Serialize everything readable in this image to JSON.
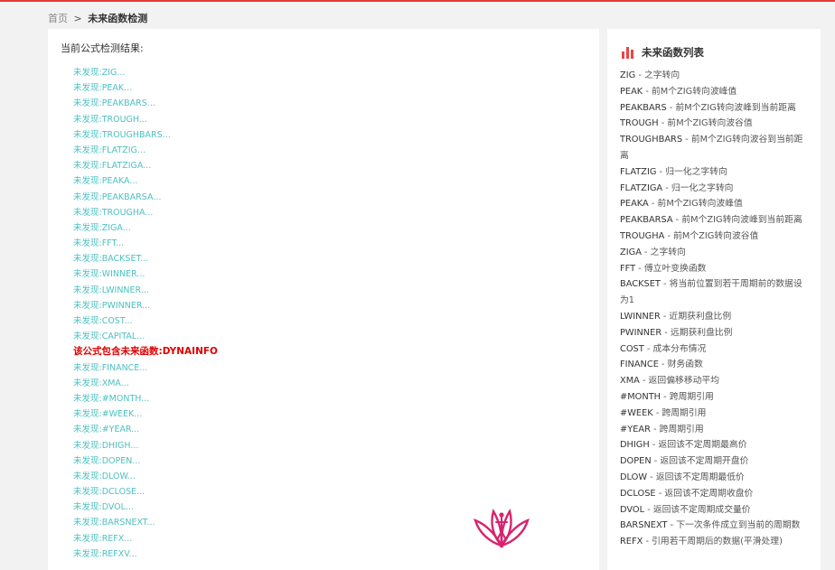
{
  "breadcrumb": {
    "home": "首页",
    "separator": ">",
    "current": "未来函数检测"
  },
  "left": {
    "title": "当前公式检测结果:",
    "results": [
      {
        "text": "未发现:ZIG...",
        "found": false
      },
      {
        "text": "未发现:PEAK...",
        "found": false
      },
      {
        "text": "未发现:PEAKBARS...",
        "found": false
      },
      {
        "text": "未发现:TROUGH...",
        "found": false
      },
      {
        "text": "未发现:TROUGHBARS...",
        "found": false
      },
      {
        "text": "未发现:FLATZIG...",
        "found": false
      },
      {
        "text": "未发现:FLATZIGA...",
        "found": false
      },
      {
        "text": "未发现:PEAKA...",
        "found": false
      },
      {
        "text": "未发现:PEAKBARSA...",
        "found": false
      },
      {
        "text": "未发现:TROUGHA...",
        "found": false
      },
      {
        "text": "未发现:ZIGA...",
        "found": false
      },
      {
        "text": "未发现:FFT...",
        "found": false
      },
      {
        "text": "未发现:BACKSET...",
        "found": false
      },
      {
        "text": "未发现:WINNER...",
        "found": false
      },
      {
        "text": "未发现:LWINNER...",
        "found": false
      },
      {
        "text": "未发现:PWINNER...",
        "found": false
      },
      {
        "text": "未发现:COST...",
        "found": false
      },
      {
        "text": "未发现:CAPITAL...",
        "found": false
      },
      {
        "text": "该公式包含未来函数:DYNAINFO",
        "found": true
      },
      {
        "text": "未发现:FINANCE...",
        "found": false
      },
      {
        "text": "未发现:XMA...",
        "found": false
      },
      {
        "text": "未发现:#MONTH...",
        "found": false
      },
      {
        "text": "未发现:#WEEK...",
        "found": false
      },
      {
        "text": "未发现:#YEAR...",
        "found": false
      },
      {
        "text": "未发现:DHIGH...",
        "found": false
      },
      {
        "text": "未发现:DOPEN...",
        "found": false
      },
      {
        "text": "未发现:DLOW...",
        "found": false
      },
      {
        "text": "未发现:DCLOSE...",
        "found": false
      },
      {
        "text": "未发现:DVOL...",
        "found": false
      },
      {
        "text": "未发现:BARSNEXT...",
        "found": false
      },
      {
        "text": "未发现:REFX...",
        "found": false
      },
      {
        "text": "未发现:REFXV...",
        "found": false
      }
    ]
  },
  "right": {
    "icon": "bar-chart-icon",
    "title": "未来函数列表",
    "functions": [
      {
        "name": "ZIG",
        "desc": " - 之字转向"
      },
      {
        "name": "PEAK",
        "desc": " - 前M个ZIG转向波峰值"
      },
      {
        "name": "PEAKBARS",
        "desc": " - 前M个ZIG转向波峰到当前距离"
      },
      {
        "name": "TROUGH",
        "desc": " - 前M个ZIG转向波谷值"
      },
      {
        "name": "TROUGHBARS",
        "desc": " - 前M个ZIG转向波谷到当前距离"
      },
      {
        "name": "FLATZIG",
        "desc": " - 归一化之字转向"
      },
      {
        "name": "FLATZIGA",
        "desc": " - 归一化之字转向"
      },
      {
        "name": "PEAKA",
        "desc": " - 前M个ZIG转向波峰值"
      },
      {
        "name": "PEAKBARSA",
        "desc": " - 前M个ZIG转向波峰到当前距离"
      },
      {
        "name": "TROUGHA",
        "desc": " - 前M个ZIG转向波谷值"
      },
      {
        "name": "ZIGA",
        "desc": " - 之字转向"
      },
      {
        "name": "FFT",
        "desc": " - 傅立叶变换函数"
      },
      {
        "name": "BACKSET",
        "desc": " - 将当前位置到若干周期前的数据设为1"
      },
      {
        "name": "LWINNER",
        "desc": " - 近期获利盘比例"
      },
      {
        "name": "PWINNER",
        "desc": " - 远期获利盘比例"
      },
      {
        "name": "COST",
        "desc": " - 成本分布情况"
      },
      {
        "name": "FINANCE",
        "desc": " - 财务函数"
      },
      {
        "name": "XMA",
        "desc": " - 返回偏移移动平均"
      },
      {
        "name": "#MONTH",
        "desc": " - 跨周期引用"
      },
      {
        "name": "#WEEK",
        "desc": " - 跨周期引用"
      },
      {
        "name": "#YEAR",
        "desc": " - 跨周期引用"
      },
      {
        "name": "DHIGH",
        "desc": " - 返回该不定周期最高价"
      },
      {
        "name": "DOPEN",
        "desc": " - 返回该不定周期开盘价"
      },
      {
        "name": "DLOW",
        "desc": " - 返回该不定周期最低价"
      },
      {
        "name": "DCLOSE",
        "desc": " - 返回该不定周期收盘价"
      },
      {
        "name": "DVOL",
        "desc": " - 返回该不定周期成交量价"
      },
      {
        "name": "BARSNEXT",
        "desc": " - 下一次条件成立到当前的周期数"
      },
      {
        "name": "REFX",
        "desc": " - 引用若干周期后的数据(平滑处理)"
      }
    ]
  },
  "colors": {
    "accent": "#e03a3a",
    "not_found": "#4ec0c0",
    "found": "#e00000",
    "logo": "#d6246e"
  },
  "logo_icon": "lotus-logo-icon"
}
